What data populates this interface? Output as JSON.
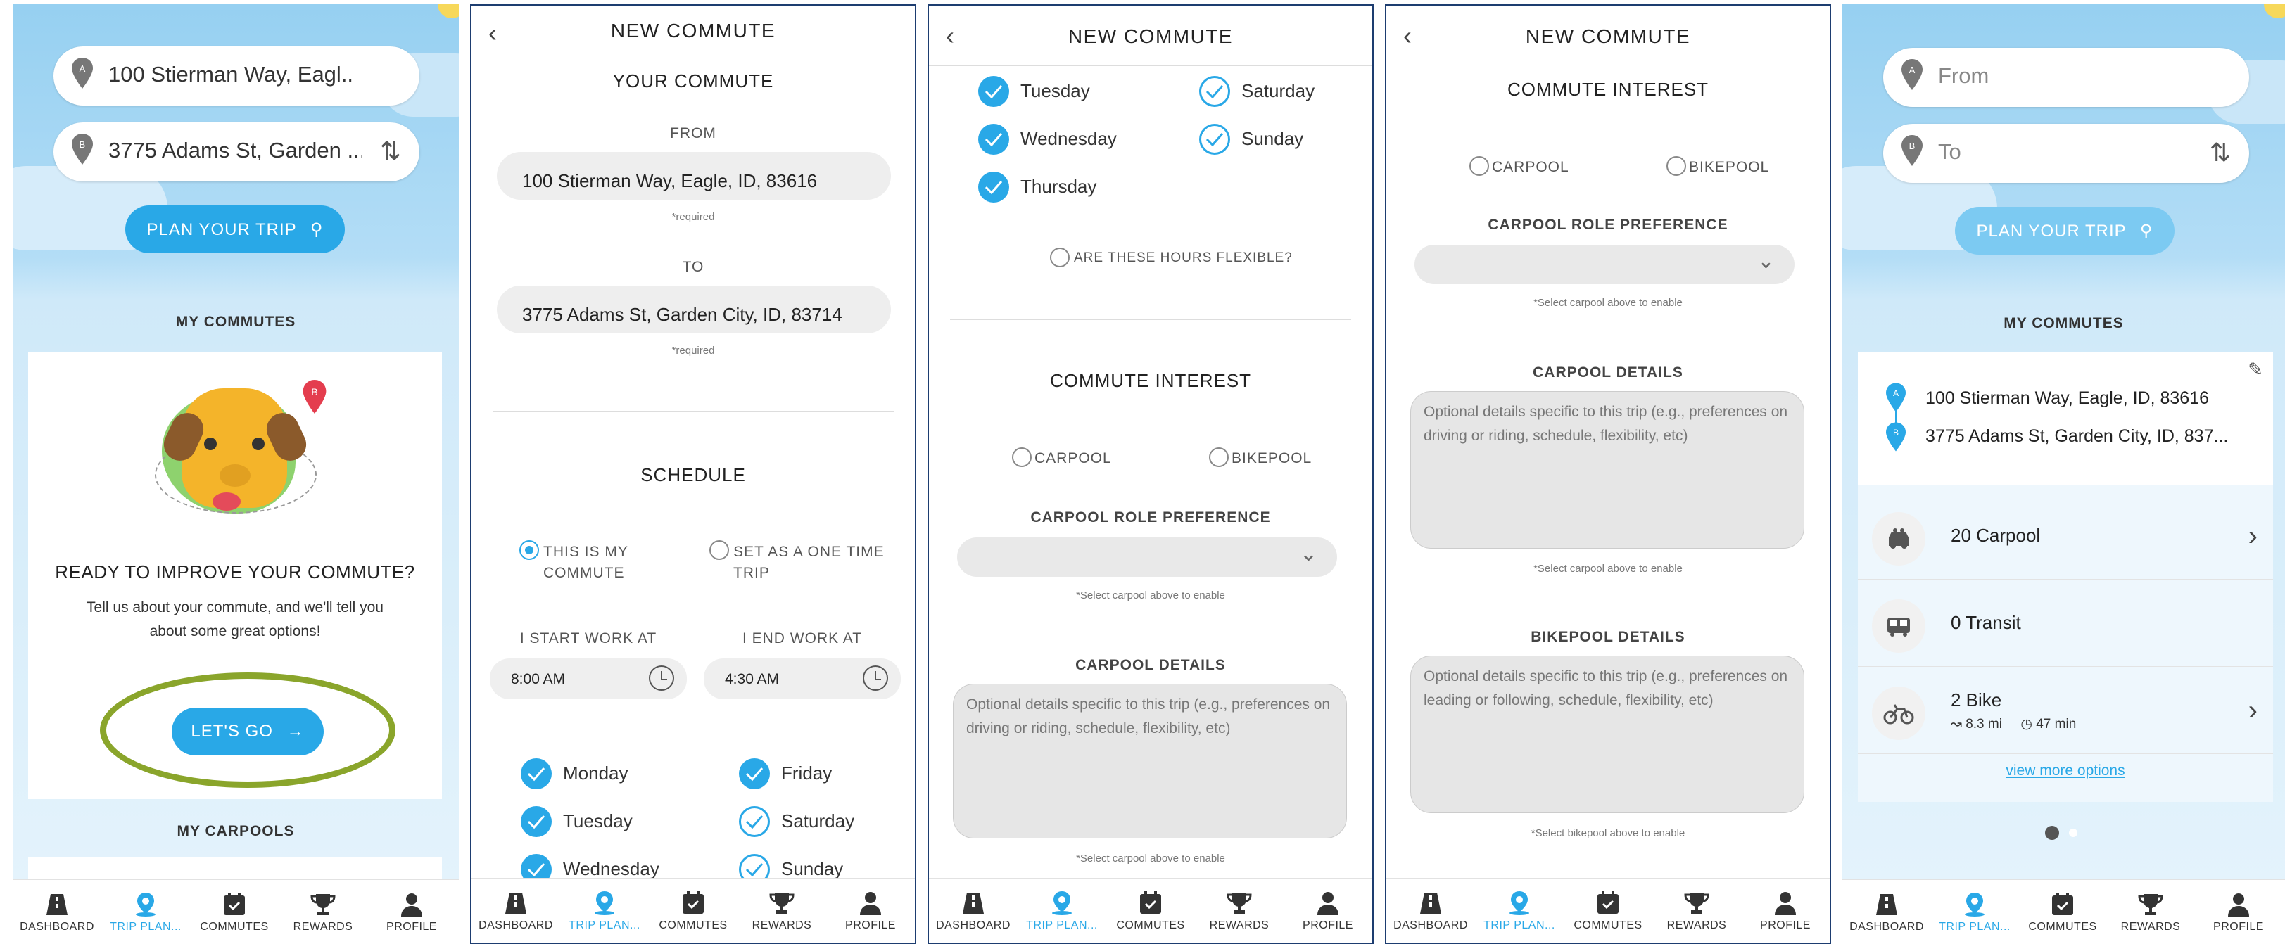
{
  "nav": [
    "DASHBOARD",
    "TRIP PLAN...",
    "COMMUTES",
    "REWARDS",
    "PROFILE"
  ],
  "s1": {
    "from": "100 Stierman Way, Eagl...",
    "to": "3775 Adams St, Garden ...",
    "plan": "PLAN YOUR TRIP",
    "my_commutes": "MY COMMUTES",
    "ready": "READY TO IMPROVE YOUR COMMUTE?",
    "tell1": "Tell us about your commute, and we'll tell you",
    "tell2": "about some great options!",
    "go": "LET'S GO",
    "carpools": "MY CARPOOLS"
  },
  "s2": {
    "title": "NEW COMMUTE",
    "your": "YOUR COMMUTE",
    "from_lbl": "FROM",
    "from_val": "100 Stierman Way, Eagle, ID, 83616",
    "req": "*required",
    "to_lbl": "TO",
    "to_val": "3775 Adams St, Garden City, ID, 83714",
    "schedule": "SCHEDULE",
    "opt1a": "THIS IS MY",
    "opt1b": "COMMUTE",
    "opt2a": "SET AS A ONE TIME",
    "opt2b": "TRIP",
    "start_lbl": "I START WORK AT",
    "end_lbl": "I END WORK AT",
    "start": "8:00 AM",
    "end": "4:30 AM",
    "days": [
      "Monday",
      "Friday",
      "Tuesday",
      "Saturday",
      "Wednesday",
      "Sunday"
    ]
  },
  "s3": {
    "title": "NEW COMMUTE",
    "days": [
      "Tuesday",
      "Saturday",
      "Wednesday",
      "Sunday",
      "Thursday"
    ],
    "flex": "ARE THESE HOURS FLEXIBLE?",
    "interest": "COMMUTE INTEREST",
    "carpool": "CARPOOL",
    "bikepool": "BIKEPOOL",
    "role": "CARPOOL ROLE PREFERENCE",
    "sel_hint": "*Select carpool above to enable",
    "details": "CARPOOL DETAILS",
    "ph": "Optional details specific to this trip (e.g., preferences on driving or riding, schedule, flexibility, etc)",
    "sel_hint2": "*Select carpool above to enable"
  },
  "s4": {
    "title": "NEW COMMUTE",
    "interest": "COMMUTE INTEREST",
    "carpool": "CARPOOL",
    "bikepool": "BIKEPOOL",
    "role": "CARPOOL ROLE PREFERENCE",
    "hint1": "*Select carpool above to enable",
    "cdetails": "CARPOOL DETAILS",
    "cph": "Optional details specific to this trip (e.g., preferences on driving or riding, schedule, flexibility, etc)",
    "hint2": "*Select carpool above to enable",
    "bdetails": "BIKEPOOL DETAILS",
    "bph": "Optional details specific to this trip (e.g., preferences on leading or following, schedule, flexibility, etc)",
    "hint3": "*Select bikepool above to enable"
  },
  "s5": {
    "from_ph": "From",
    "to_ph": "To",
    "plan": "PLAN YOUR TRIP",
    "my_commutes": "MY COMMUTES",
    "addr1": "100 Stierman Way, Eagle, ID, 83616",
    "addr2": "3775 Adams St, Garden City, ID, 837...",
    "carpool": "20 Carpool",
    "transit": "0 Transit",
    "bike": "2 Bike",
    "bike_dist": "8.3 mi",
    "bike_time": "47 min",
    "more": "view more options"
  },
  "colors": {
    "accent": "#29a8e7",
    "sky": "#a6d7f3",
    "highlight": "#8aa52b",
    "frame": "#1d3d70"
  }
}
